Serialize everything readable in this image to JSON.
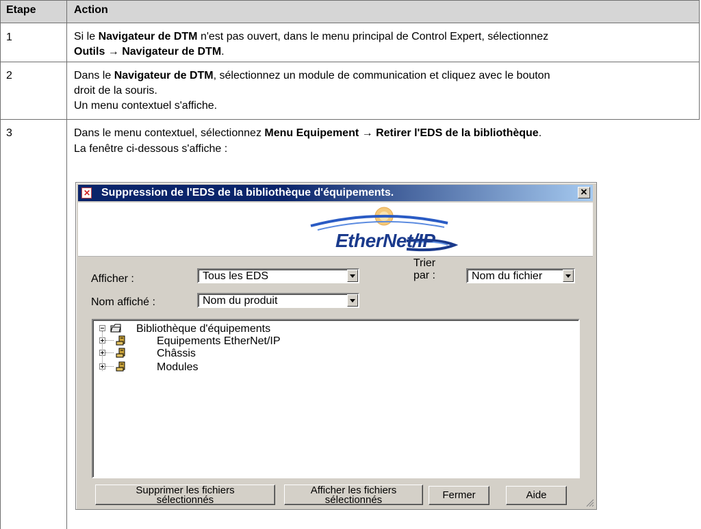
{
  "table": {
    "headers": [
      "Etape",
      "Action"
    ],
    "rows": [
      {
        "step": "1",
        "parts": [
          {
            "t": "Si le ",
            "b": false
          },
          {
            "t": "Navigateur de DTM",
            "b": true
          },
          {
            "t": " n'est pas ouvert, dans le menu principal de Control Expert, sélectionnez",
            "b": false
          },
          {
            "t": "Outils → Navigateur de DTM",
            "b": true
          },
          {
            "t": ".",
            "b": false
          }
        ]
      },
      {
        "step": "2",
        "parts": [
          {
            "t": "Dans le ",
            "b": false
          },
          {
            "t": "Navigateur de DTM",
            "b": true
          },
          {
            "t": ", sélectionnez un module de communication et cliquez avec le bouton",
            "b": false
          },
          {
            "t": "droit de la souris.",
            "b": false
          },
          {
            "t": "Un menu contextuel s'affiche.",
            "b": false
          }
        ]
      },
      {
        "step": "3",
        "parts": [
          {
            "t": "Dans le menu contextuel, sélectionnez ",
            "b": false
          },
          {
            "t": "Menu Equipement → Retirer l'EDS de la bibliothèque",
            "b": true
          },
          {
            "t": ".",
            "b": false
          },
          {
            "t": "La fenêtre ci-dessous s'affiche :",
            "b": false
          }
        ]
      }
    ]
  },
  "dialog": {
    "title": "Suppression de l'EDS de la bibliothèque d'équipements.",
    "close_glyph": "✕",
    "logo_text": "EtherNet/IP",
    "afficher_label": "Afficher :",
    "afficher_value": "Tous les EDS",
    "trier_label_line1": "Trier",
    "trier_label_line2": "par :",
    "trier_value": "Nom du fichier",
    "nom_affiche_label": "Nom affiché :",
    "nom_affiche_value": "Nom du produit",
    "tree": {
      "root": "Bibliothèque d'équipements",
      "children": [
        "Equipements EtherNet/IP",
        "Châssis",
        "Modules"
      ]
    },
    "buttons": {
      "supprimer_line1": "Supprimer les fichiers",
      "supprimer_line2": "sélectionnés",
      "afficher_line1": "Afficher les fichiers",
      "afficher_line2": "sélectionnés",
      "fermer": "Fermer",
      "aide": "Aide"
    }
  }
}
